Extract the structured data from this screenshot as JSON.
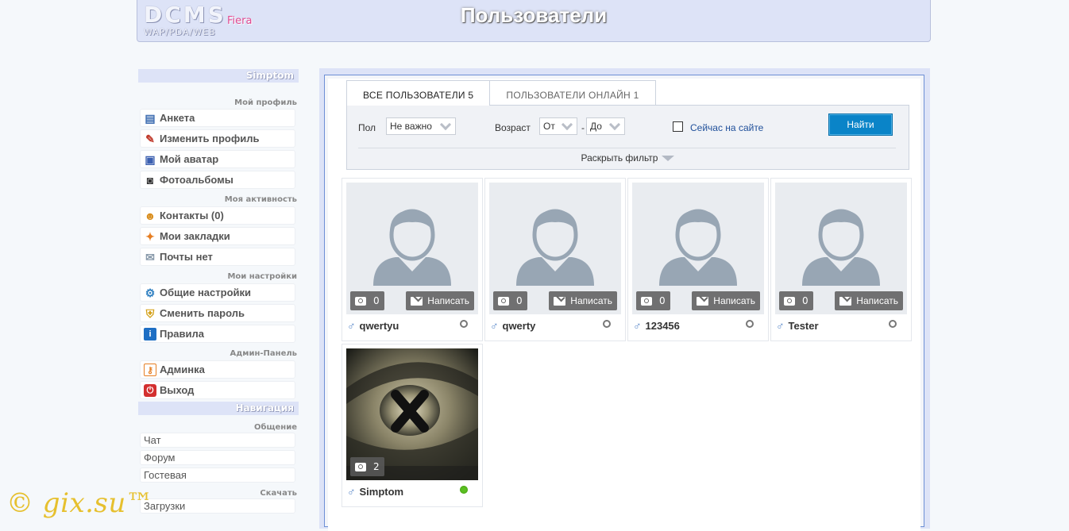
{
  "header": {
    "logo_main": "DCMS",
    "logo_sub": "WAP/PDA/WEB",
    "logo_accent": "Fiera",
    "title": "Пользователи"
  },
  "sidebar": {
    "user_header": "Simptom",
    "profile_section": "Мой профиль",
    "profile_items": [
      {
        "label": "Анкета",
        "icon": "id-card-icon"
      },
      {
        "label": "Изменить профиль",
        "icon": "edit-icon"
      },
      {
        "label": "Мой аватар",
        "icon": "avatar-icon"
      },
      {
        "label": "Фотоальбомы",
        "icon": "camera-icon"
      }
    ],
    "activity_section": "Моя активность",
    "activity_items": [
      {
        "label": "Контакты (0)",
        "icon": "contacts-icon"
      },
      {
        "label": "Мои закладки",
        "icon": "bookmarks-icon"
      },
      {
        "label": "Почты нет",
        "icon": "mail-icon"
      }
    ],
    "settings_section": "Мои настройки",
    "settings_items": [
      {
        "label": "Общие настройки",
        "icon": "gear-icon"
      },
      {
        "label": "Сменить пароль",
        "icon": "shield-icon"
      },
      {
        "label": "Правила",
        "icon": "info-icon"
      }
    ],
    "admin_section": "Админ-Панель",
    "admin_items": [
      {
        "label": "Админка",
        "icon": "key-icon"
      },
      {
        "label": "Выход",
        "icon": "power-icon"
      }
    ],
    "nav_header": "Навигация",
    "social_section": "Общение",
    "social_items": [
      "Чат",
      "Форум",
      "Гостевая"
    ],
    "download_section": "Скачать",
    "download_items": [
      "Загрузки"
    ]
  },
  "tabs": [
    "ВСЕ ПОЛЬЗОВАТЕЛИ 5",
    "ПОЛЬЗОВАТЕЛИ ОНЛАЙН 1"
  ],
  "filter": {
    "gender_label": "Пол",
    "gender_value": "Не важно",
    "age_label": "Возраст",
    "age_from": "От",
    "age_separator": "-",
    "age_to": "До",
    "online_label": "Сейчас на сайте",
    "find_button": "Найти",
    "expand_label": "Раскрыть фильтр"
  },
  "message_label": "Написать",
  "users": [
    {
      "name": "qwertyu",
      "photos": "0",
      "online": false
    },
    {
      "name": "qwerty",
      "photos": "0",
      "online": false
    },
    {
      "name": "123456",
      "photos": "0",
      "online": false
    },
    {
      "name": "Tester",
      "photos": "0",
      "online": false
    },
    {
      "name": "Simptom",
      "photos": "2",
      "online": true
    }
  ],
  "colors": {
    "accent_blue": "#0a84c8",
    "online_green": "#5bbf21",
    "header_bg": "#dde3f7"
  },
  "watermark": "© gix.su™"
}
